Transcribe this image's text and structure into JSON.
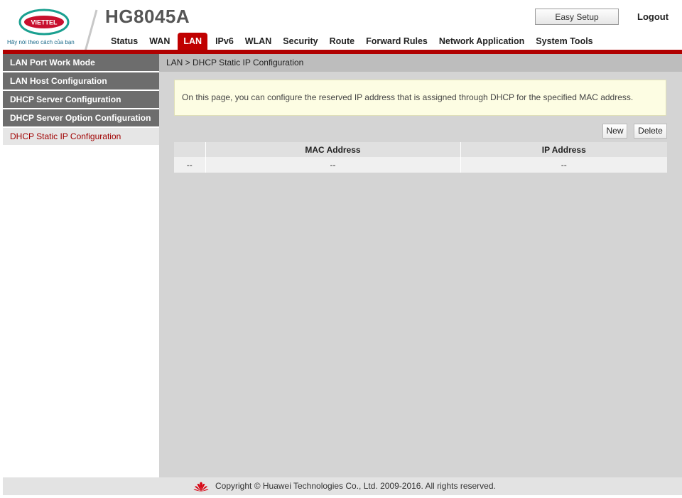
{
  "header": {
    "brand": "VIETTEL",
    "slogan": "Hãy nói theo cách của bạn",
    "model": "HG8045A",
    "easy_setup_label": "Easy Setup",
    "logout_label": "Logout",
    "nav": [
      {
        "label": "Status"
      },
      {
        "label": "WAN"
      },
      {
        "label": "LAN",
        "active": true
      },
      {
        "label": "IPv6"
      },
      {
        "label": "WLAN"
      },
      {
        "label": "Security"
      },
      {
        "label": "Route"
      },
      {
        "label": "Forward Rules"
      },
      {
        "label": "Network Application"
      },
      {
        "label": "System Tools"
      }
    ]
  },
  "sidebar": {
    "items": [
      {
        "label": "LAN Port Work Mode"
      },
      {
        "label": "LAN Host Configuration"
      },
      {
        "label": "DHCP Server Configuration"
      },
      {
        "label": "DHCP Server Option Configuration"
      },
      {
        "label": "DHCP Static IP Configuration",
        "active": true
      }
    ]
  },
  "main": {
    "breadcrumb": "LAN > DHCP Static IP Configuration",
    "info": "On this page, you can configure the reserved IP address that is assigned through DHCP for the specified MAC address.",
    "new_label": "New",
    "delete_label": "Delete",
    "table": {
      "headers": [
        "",
        "MAC Address",
        "IP Address"
      ],
      "rows": [
        [
          "--",
          "--",
          "--"
        ]
      ]
    }
  },
  "footer": {
    "copyright": "Copyright © Huawei Technologies Co., Ltd. 2009-2016. All rights reserved."
  },
  "colors": {
    "accent_red": "#b00000",
    "sidebar_item": "#6d6d6d",
    "active_sidebar_text": "#a00000",
    "content_bg": "#d4d4d4",
    "info_bg": "#fdfde3"
  }
}
